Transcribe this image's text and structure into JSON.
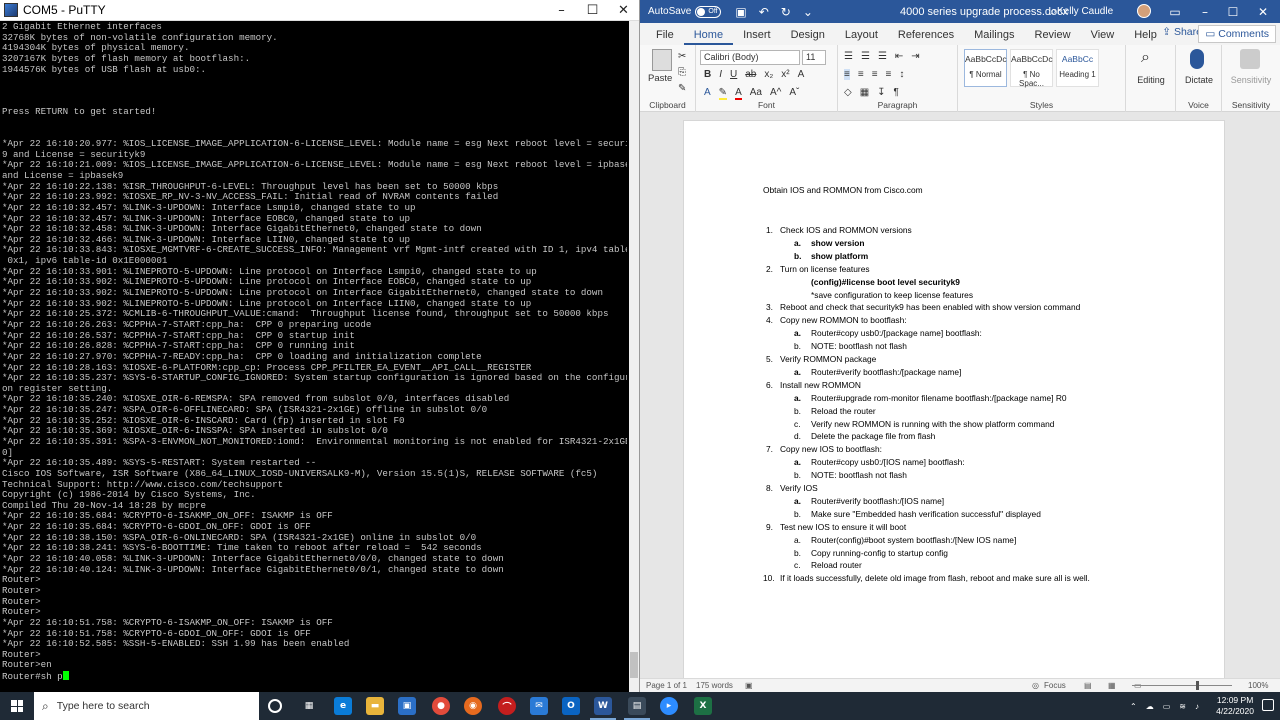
{
  "putty": {
    "title": "COM5 - PuTTY",
    "controls": {
      "minimize": "–",
      "maximize": "☐",
      "close": "✕"
    },
    "lines": [
      "2 Gigabit Ethernet interfaces",
      "32768K bytes of non-volatile configuration memory.",
      "4194304K bytes of physical memory.",
      "3207167K bytes of flash memory at bootflash:.",
      "1944576K bytes of USB flash at usb0:.",
      "",
      "",
      "",
      "Press RETURN to get started!",
      "",
      "",
      "*Apr 22 16:10:20.977: %IOS_LICENSE_IMAGE_APPLICATION-6-LICENSE_LEVEL: Module name = esg Next reboot level = securityk",
      "9 and License = securityk9",
      "*Apr 22 16:10:21.009: %IOS_LICENSE_IMAGE_APPLICATION-6-LICENSE_LEVEL: Module name = esg Next reboot level = ipbasek9",
      "and License = ipbasek9",
      "*Apr 22 16:10:22.138: %ISR_THROUGHPUT-6-LEVEL: Throughput level has been set to 50000 kbps",
      "*Apr 22 16:10:23.992: %IOSXE_RP_NV-3-NV_ACCESS_FAIL: Initial read of NVRAM contents failed",
      "*Apr 22 16:10:32.457: %LINK-3-UPDOWN: Interface Lsmpi0, changed state to up",
      "*Apr 22 16:10:32.457: %LINK-3-UPDOWN: Interface EOBC0, changed state to up",
      "*Apr 22 16:10:32.458: %LINK-3-UPDOWN: Interface GigabitEthernet0, changed state to down",
      "*Apr 22 16:10:32.466: %LINK-3-UPDOWN: Interface LIIN0, changed state to up",
      "*Apr 22 16:10:33.843: %IOSXE_MGMTVRF-6-CREATE_SUCCESS_INFO: Management vrf Mgmt-intf created with ID 1, ipv4 table-id",
      " 0x1, ipv6 table-id 0x1E000001",
      "*Apr 22 16:10:33.901: %LINEPROTO-5-UPDOWN: Line protocol on Interface Lsmpi0, changed state to up",
      "*Apr 22 16:10:33.902: %LINEPROTO-5-UPDOWN: Line protocol on Interface EOBC0, changed state to up",
      "*Apr 22 16:10:33.902: %LINEPROTO-5-UPDOWN: Line protocol on Interface GigabitEthernet0, changed state to down",
      "*Apr 22 16:10:33.902: %LINEPROTO-5-UPDOWN: Line protocol on Interface LIIN0, changed state to up",
      "*Apr 22 16:10:25.372: %CMLIB-6-THROUGHPUT_VALUE:cmand:  Throughput license found, throughput set to 50000 kbps",
      "*Apr 22 16:10:26.263: %CPPHA-7-START:cpp_ha:  CPP 0 preparing ucode",
      "*Apr 22 16:10:26.537: %CPPHA-7-START:cpp_ha:  CPP 0 startup init",
      "*Apr 22 16:10:26.828: %CPPHA-7-START:cpp_ha:  CPP 0 running init",
      "*Apr 22 16:10:27.970: %CPPHA-7-READY:cpp_ha:  CPP 0 loading and initialization complete",
      "*Apr 22 16:10:28.163: %IOSXE-6-PLATFORM:cpp_cp: Process CPP_PFILTER_EA_EVENT__API_CALL__REGISTER",
      "*Apr 22 16:10:35.237: %SYS-6-STARTUP_CONFIG_IGNORED: System startup configuration is ignored based on the configurati",
      "on register setting.",
      "*Apr 22 16:10:35.240: %IOSXE_OIR-6-REMSPA: SPA removed from subslot 0/0, interfaces disabled",
      "*Apr 22 16:10:35.247: %SPA_OIR-6-OFFLINECARD: SPA (ISR4321-2x1GE) offline in subslot 0/0",
      "*Apr 22 16:10:35.252: %IOSXE_OIR-6-INSCARD: Card (fp) inserted in slot F0",
      "*Apr 22 16:10:35.369: %IOSXE_OIR-6-INSSPA: SPA inserted in subslot 0/0",
      "*Apr 22 16:10:35.391: %SPA-3-ENVMON_NOT_MONITORED:iomd:  Environmental monitoring is not enabled for ISR4321-2x1GE[0/",
      "0]",
      "*Apr 22 16:10:35.489: %SYS-5-RESTART: System restarted --",
      "Cisco IOS Software, ISR Software (X86_64_LINUX_IOSD-UNIVERSALK9-M), Version 15.5(1)S, RELEASE SOFTWARE (fc5)",
      "Technical Support: http://www.cisco.com/techsupport",
      "Copyright (c) 1986-2014 by Cisco Systems, Inc.",
      "Compiled Thu 20-Nov-14 18:28 by mcpre",
      "*Apr 22 16:10:35.684: %CRYPTO-6-ISAKMP_ON_OFF: ISAKMP is OFF",
      "*Apr 22 16:10:35.684: %CRYPTO-6-GDOI_ON_OFF: GDOI is OFF",
      "*Apr 22 16:10:38.150: %SPA_OIR-6-ONLINECARD: SPA (ISR4321-2x1GE) online in subslot 0/0",
      "*Apr 22 16:10:38.241: %SYS-6-BOOTTIME: Time taken to reboot after reload =  542 seconds",
      "*Apr 22 16:10:40.058: %LINK-3-UPDOWN: Interface GigabitEthernet0/0/0, changed state to down",
      "*Apr 22 16:10:40.124: %LINK-3-UPDOWN: Interface GigabitEthernet0/0/1, changed state to down",
      "Router>",
      "Router>",
      "Router>",
      "Router>",
      "*Apr 22 16:10:51.758: %CRYPTO-6-ISAKMP_ON_OFF: ISAKMP is OFF",
      "*Apr 22 16:10:51.758: %CRYPTO-6-GDOI_ON_OFF: GDOI is OFF",
      "*Apr 22 16:10:52.585: %SSH-5-ENABLED: SSH 1.99 has been enabled",
      "Router>",
      "Router>en"
    ],
    "prompt": "Router#sh p"
  },
  "word": {
    "autosave_label": "AutoSave",
    "autosave_state": "Off",
    "doc_title": "4000 series upgrade process.docx",
    "user_name": "Kelly Caudle",
    "tabs": [
      "File",
      "Home",
      "Insert",
      "Design",
      "Layout",
      "References",
      "Mailings",
      "Review",
      "View",
      "Help"
    ],
    "active_tab": "Home",
    "share_label": "Share",
    "comments_label": "Comments",
    "ribbon": {
      "paste_label": "Paste",
      "clipboard_label": "Clipboard",
      "font_name": "Calibri (Body)",
      "font_size": "11",
      "font_label": "Font",
      "paragraph_label": "Paragraph",
      "styles_label": "Styles",
      "styles": [
        {
          "preview": "AaBbCcDc",
          "name": "¶ Normal"
        },
        {
          "preview": "AaBbCcDc",
          "name": "¶ No Spac..."
        },
        {
          "preview": "AaBbCc",
          "name": "Heading 1"
        }
      ],
      "editing_label": "Editing",
      "dictate_label": "Dictate",
      "sensitivity_label": "Sensitivity",
      "voice_label": "Voice",
      "sensitivity_group_label": "Sensitivity",
      "format_buttons": [
        "B",
        "I",
        "U",
        "ab",
        "x₂",
        "x²",
        "A"
      ]
    },
    "document": {
      "title": "Obtain IOS and ROMMON from Cisco.com",
      "items": [
        {
          "num": "1.",
          "text": "Check IOS and ROMMON versions"
        },
        {
          "num": "a.",
          "text": "show version"
        },
        {
          "num": "b.",
          "text": "show platform"
        },
        {
          "num": "2.",
          "text": "Turn on license features"
        },
        {
          "num": "",
          "text": "(config)#license boot level securityk9"
        },
        {
          "num": "",
          "text": "*save configuration to keep license features"
        },
        {
          "num": "3.",
          "text": "Reboot and check that securityk9 has been enabled with show version command"
        },
        {
          "num": "4.",
          "text": "Copy new ROMMON to bootflash:"
        },
        {
          "num": "a.",
          "text": "Router#copy usb0:/[package name] bootflash:"
        },
        {
          "num": "b.",
          "text": "NOTE: bootflash not flash"
        },
        {
          "num": "5.",
          "text": "Verify ROMMON package"
        },
        {
          "num": "a.",
          "text": "Router#verify bootflash:/[package name]"
        },
        {
          "num": "6.",
          "text": "Install new ROMMON"
        },
        {
          "num": "a.",
          "text": "Router#upgrade rom-monitor filename bootflash:/[package name] R0"
        },
        {
          "num": "b.",
          "text": "Reload the router"
        },
        {
          "num": "c.",
          "text": "Verify new ROMMON is running with the show platform command"
        },
        {
          "num": "d.",
          "text": "Delete the package file from flash"
        },
        {
          "num": "7.",
          "text": "Copy new IOS to bootflash:"
        },
        {
          "num": "a.",
          "text": "Router#copy usb0:/[IOS name] bootflash:"
        },
        {
          "num": "b.",
          "text": "NOTE: bootflash not flash"
        },
        {
          "num": "8.",
          "text": "Verify IOS"
        },
        {
          "num": "a.",
          "text": "Router#verify bootflash:/[IOS name]"
        },
        {
          "num": "b.",
          "text": "Make sure \"Embedded hash verification successful\" displayed"
        },
        {
          "num": "9.",
          "text": "Test new IOS to ensure it will boot"
        },
        {
          "num": "a.",
          "text": "Router(config)#boot system bootflash:/[New IOS name]"
        },
        {
          "num": "b.",
          "text": "Copy running-config to startup config"
        },
        {
          "num": "c.",
          "text": "Reload router"
        },
        {
          "num": "10.",
          "text": "If it loads successfully, delete old image from flash, reboot and make sure all is well."
        }
      ]
    },
    "status": {
      "page": "Page 1 of 1",
      "words": "175 words",
      "focus": "Focus",
      "zoom": "100%"
    }
  },
  "taskbar": {
    "search_placeholder": "Type here to search",
    "time": "12:09 PM",
    "date": "4/22/2020"
  },
  "colors": {
    "word_blue": "#2b579a",
    "terminal_bg": "#000000",
    "terminal_fg": "#c6c6c6",
    "cursor": "#00ff00",
    "taskbar": "#1f2a36"
  }
}
